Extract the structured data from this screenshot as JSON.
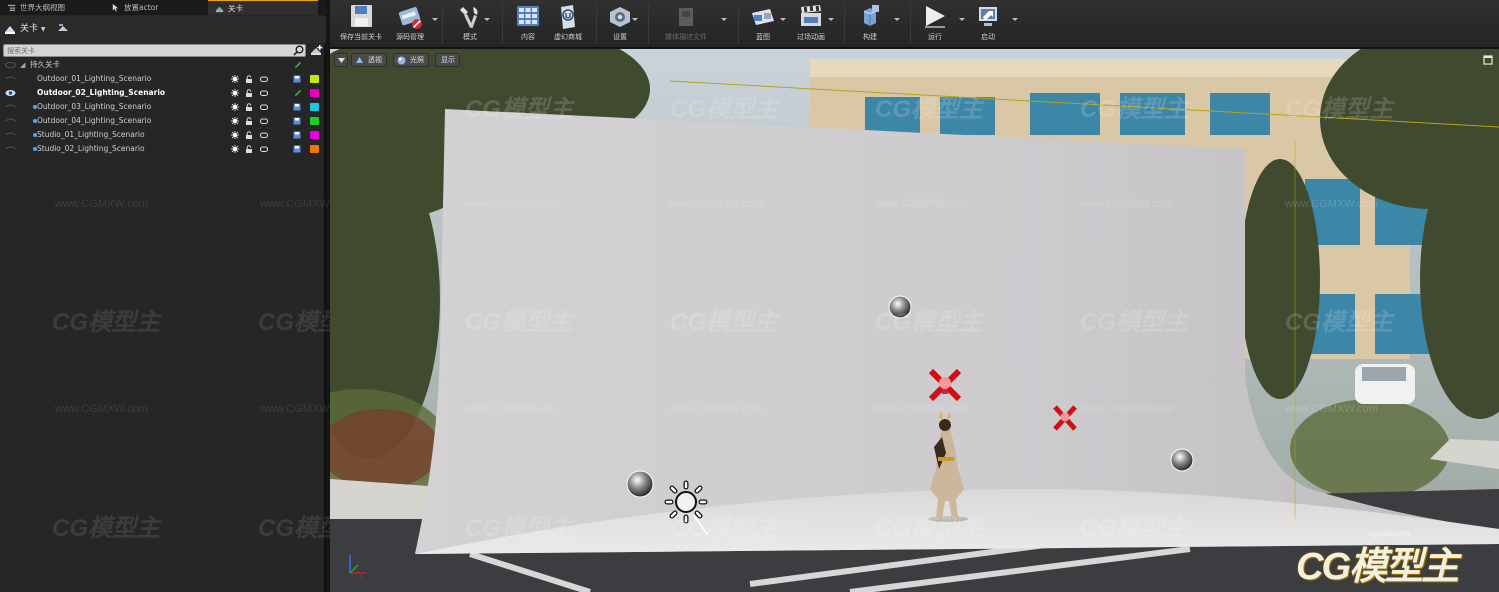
{
  "tabs": [
    {
      "label": "世界大纲视图",
      "icon": "world-outliner-icon",
      "active": false
    },
    {
      "label": "放置actor",
      "icon": "place-actor-icon",
      "active": false
    },
    {
      "label": "关卡",
      "icon": "levels-icon",
      "active": true
    }
  ],
  "levels_panel": {
    "menu_label": "关卡",
    "search_placeholder": "搜索关卡",
    "items": [
      {
        "label": "持久关卡",
        "kind": "persistent",
        "bold": false,
        "visible": false,
        "color": null
      },
      {
        "label": "Outdoor_01_Lighting_Scenario",
        "bold": false,
        "visible": false,
        "color": "#c8e600",
        "dot": false
      },
      {
        "label": "Outdoor_02_Lighting_Scenario",
        "bold": true,
        "visible": true,
        "color": "#e600c8",
        "dot": false
      },
      {
        "label": "Outdoor_03_Lighting_Scenario",
        "bold": false,
        "visible": false,
        "color": "#19c8e6",
        "dot": true
      },
      {
        "label": "Outdoor_04_Lighting_Scenario",
        "bold": false,
        "visible": false,
        "color": "#19d219",
        "dot": true
      },
      {
        "label": "Studio_01_Lighting_Scenario",
        "bold": false,
        "visible": false,
        "color": "#e600e6",
        "dot": true
      },
      {
        "label": "Studio_02_Lighting_Scenario",
        "bold": false,
        "visible": false,
        "color": "#f07800",
        "dot": true
      }
    ]
  },
  "toolbar": {
    "buttons": [
      {
        "label": "保存当前关卡",
        "icon": "save-icon",
        "name": "save-current-level-button"
      },
      {
        "label": "源码管理",
        "icon": "source-control-icon",
        "name": "source-control-button"
      },
      {
        "label": "模式",
        "icon": "modes-icon",
        "name": "modes-button"
      },
      {
        "label": "内容",
        "icon": "content-browser-icon",
        "name": "content-button"
      },
      {
        "label": "虚幻商城",
        "icon": "marketplace-icon",
        "name": "marketplace-button"
      },
      {
        "label": "设置",
        "icon": "settings-icon",
        "name": "settings-button"
      },
      {
        "label": "媒体描述文件",
        "icon": "media-profile-icon",
        "name": "media-profile-button",
        "disabled": true
      },
      {
        "label": "蓝图",
        "icon": "blueprint-icon",
        "name": "blueprints-button"
      },
      {
        "label": "过场动画",
        "icon": "cinematics-icon",
        "name": "cinematics-button"
      },
      {
        "label": "构建",
        "icon": "build-icon",
        "name": "build-button"
      },
      {
        "label": "运行",
        "icon": "play-icon",
        "name": "play-button"
      },
      {
        "label": "启动",
        "icon": "launch-icon",
        "name": "launch-button"
      }
    ]
  },
  "viewport": {
    "perspective_label": "透视",
    "lit_label": "光照",
    "show_label": "显示",
    "watermark_text": "CG模型主",
    "watermark_url": "www.CGMXW.com",
    "brand_text": "CG模型主",
    "brand_url": "cgmxw.com"
  }
}
